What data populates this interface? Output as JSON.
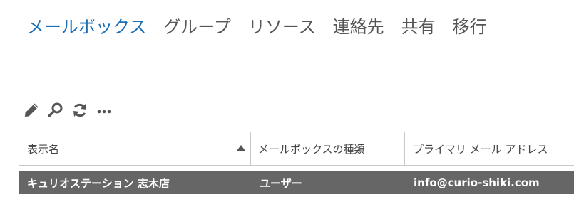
{
  "nav": {
    "tabs": [
      {
        "label": "メールボックス",
        "active": true
      },
      {
        "label": "グループ",
        "active": false
      },
      {
        "label": "リソース",
        "active": false
      },
      {
        "label": "連絡先",
        "active": false
      },
      {
        "label": "共有",
        "active": false
      },
      {
        "label": "移行",
        "active": false
      }
    ]
  },
  "toolbar": {
    "buttons": [
      {
        "icon": "pencil-icon",
        "title": "編集"
      },
      {
        "icon": "search-icon",
        "title": "検索"
      },
      {
        "icon": "refresh-icon",
        "title": "更新"
      },
      {
        "icon": "more-icon",
        "title": "その他"
      }
    ]
  },
  "table": {
    "columns": [
      "表示名",
      "メールボックスの種類",
      "プライマリ メール アドレス"
    ],
    "sort": {
      "column": 0,
      "direction": "ascending"
    },
    "rows": [
      {
        "display_name": "キュリオステーション 志木店",
        "type": "ユーザー",
        "email": "info@curio-shiki.com",
        "selected": true
      }
    ]
  },
  "colors": {
    "accent": "#1a6fb5",
    "selected_row": "#666666",
    "tab_inactive": "#555555"
  }
}
